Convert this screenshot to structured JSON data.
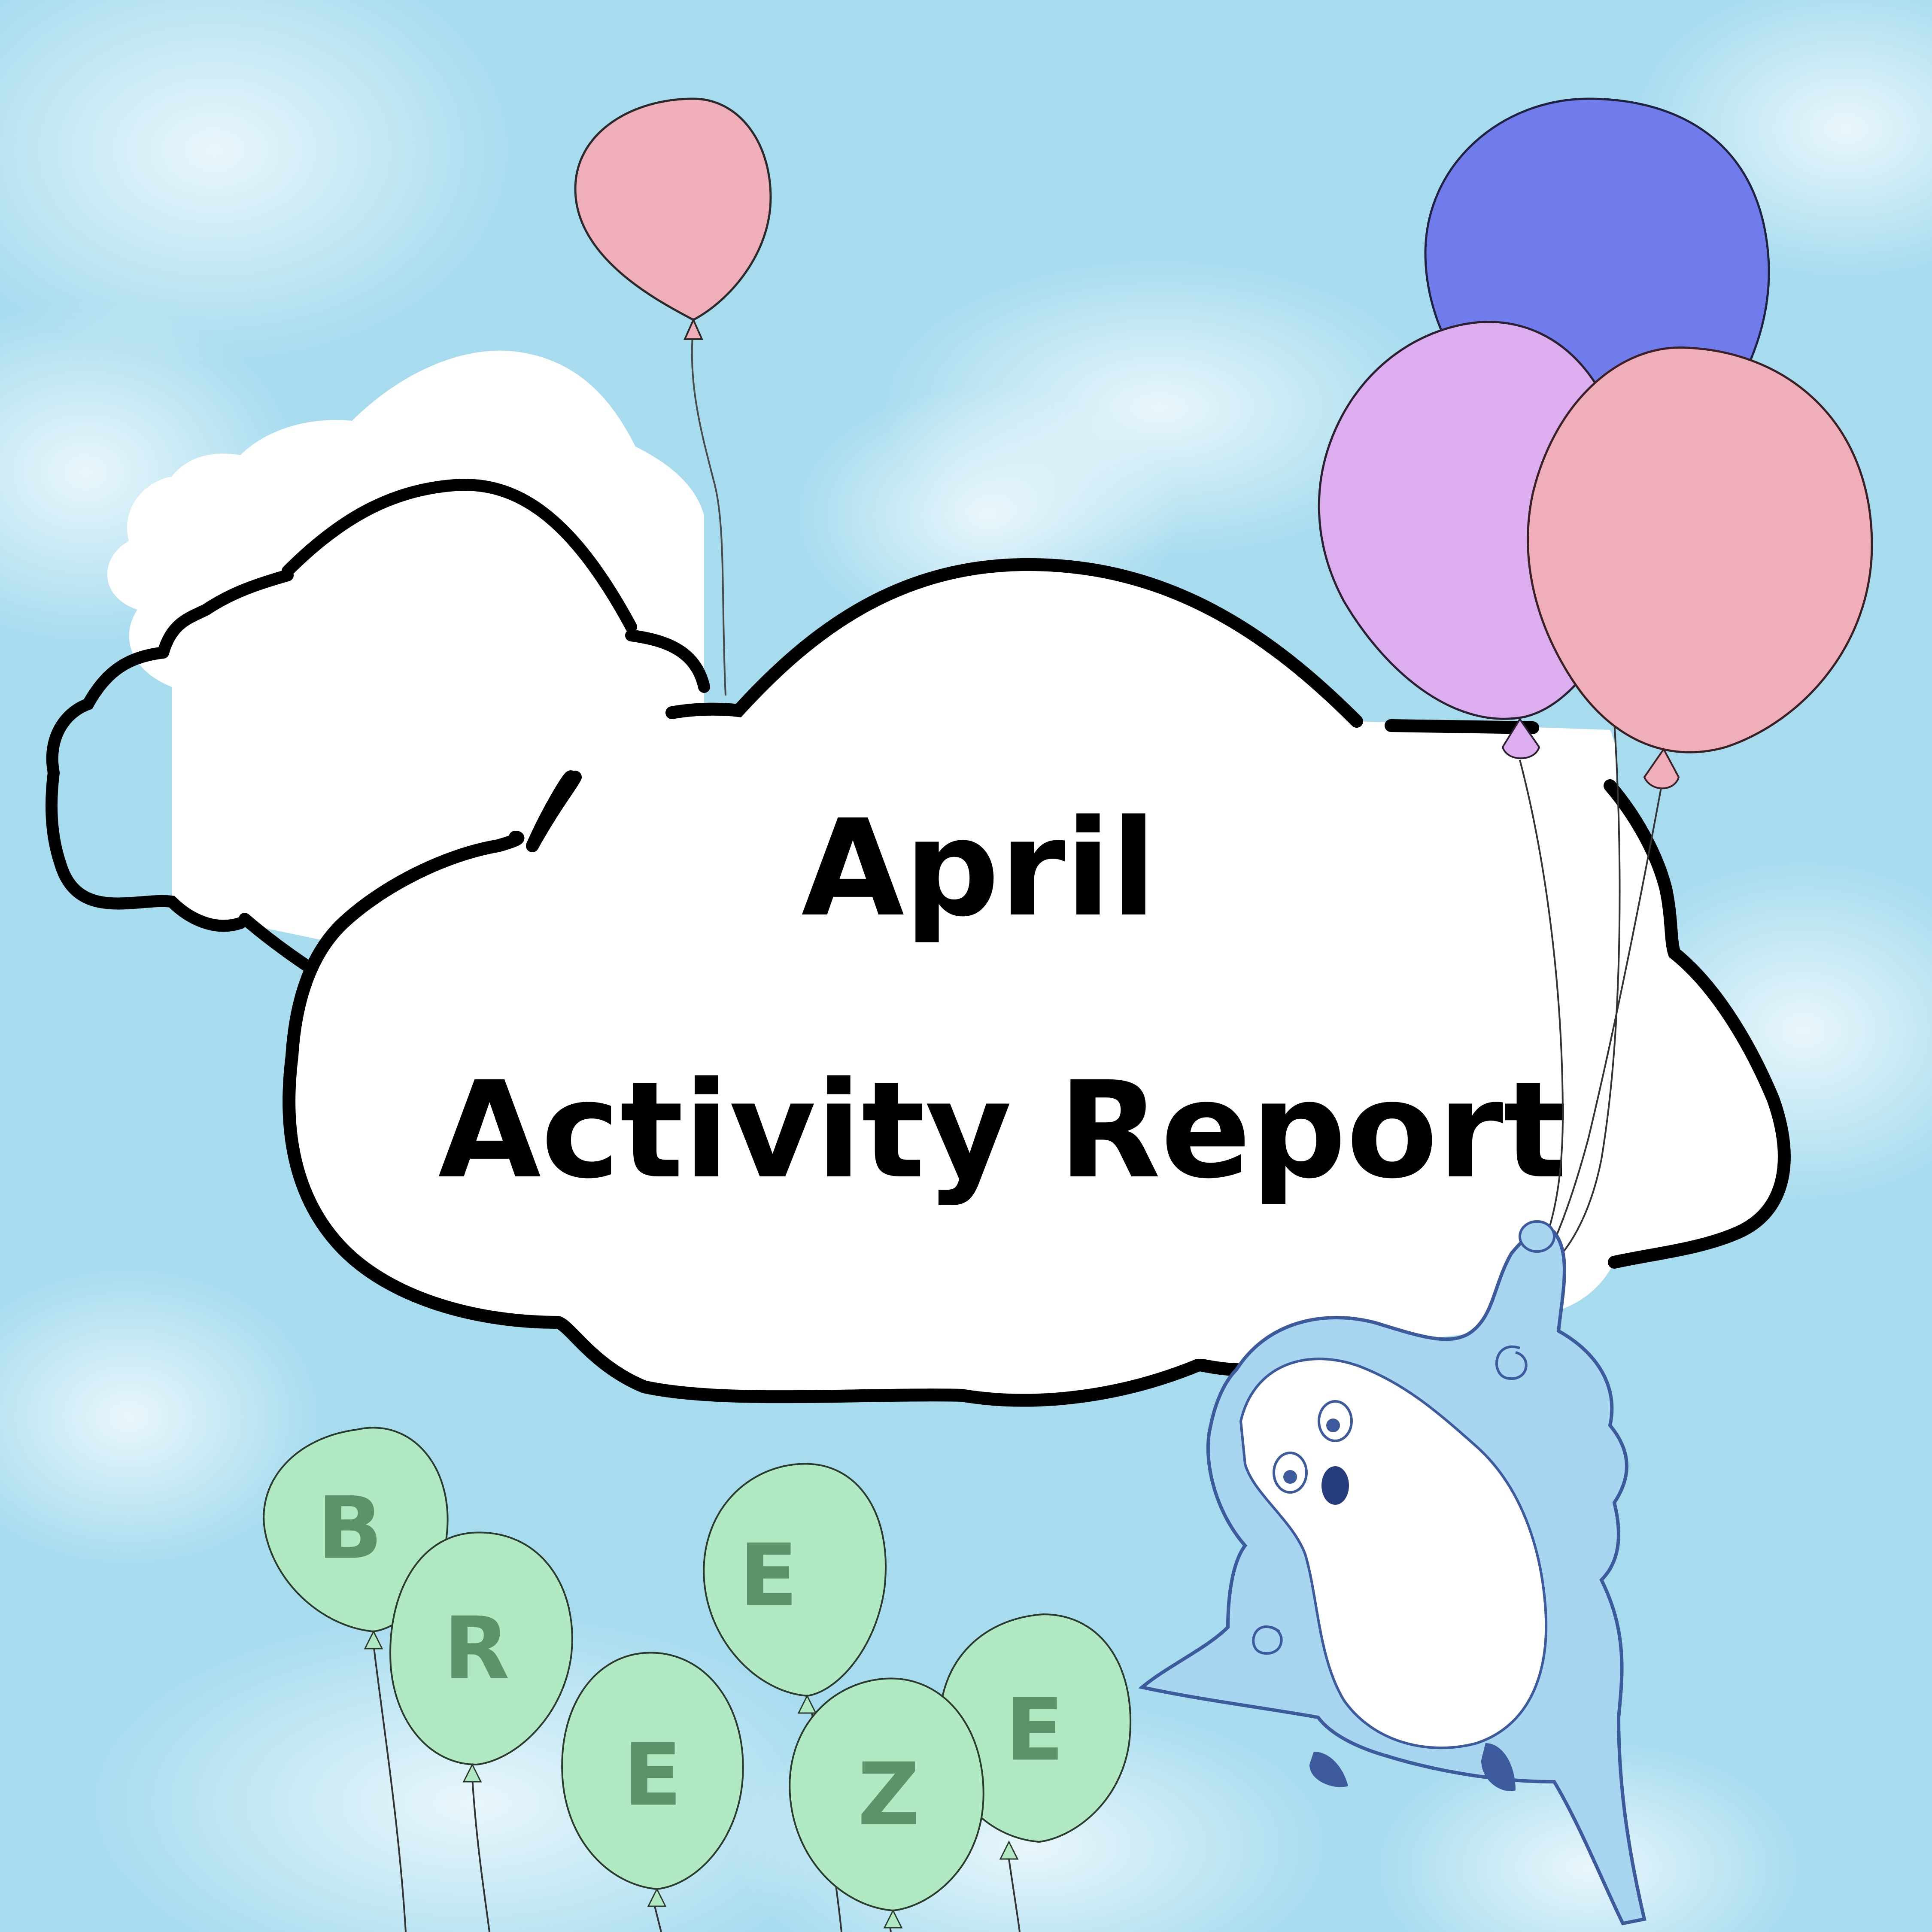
{
  "title": {
    "line1": "April",
    "line2": "Activity Report"
  },
  "letter_balloons": [
    "B",
    "R",
    "E",
    "E",
    "Z",
    "E"
  ],
  "colors": {
    "sky": "#a7dcef",
    "cloud_fill": "#ffffff",
    "cloud_outline": "#000000",
    "balloon_pink": "#f0aebb",
    "balloon_blue": "#717cec",
    "balloon_lilac": "#dcaef0",
    "balloon_green": "#b1e9c2",
    "letter_green": "#5e9269",
    "bird_blue": "#a8d6f0",
    "bird_outline": "#3d5a9c",
    "bird_belly": "#ffffff"
  },
  "icons": {
    "bird": "bird-mascot-icon",
    "balloon": "balloon-icon"
  }
}
